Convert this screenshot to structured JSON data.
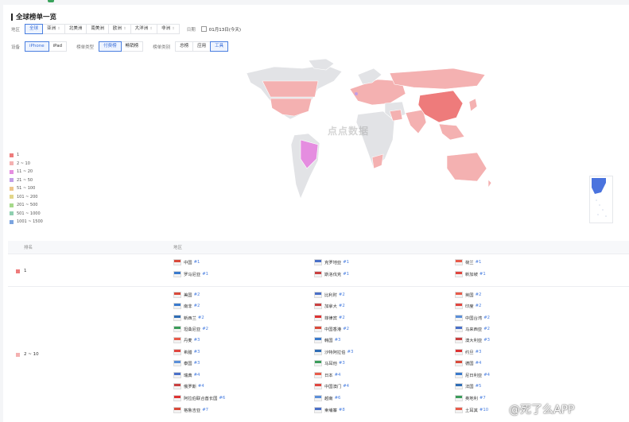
{
  "page_title": "全球榜单一览",
  "filters": {
    "region_label": "地区",
    "regions": [
      "全球",
      "亚洲",
      "北美洲",
      "南美洲",
      "欧洲",
      "大洋洲",
      "非洲"
    ],
    "regions_with_caret": [
      false,
      true,
      false,
      false,
      true,
      true,
      true
    ],
    "date_label": "日期",
    "date_value": "01月13日(今天)",
    "device_label": "设备",
    "devices": [
      "iPhone",
      "iPad"
    ],
    "list_type_label": "榜单类型",
    "list_types": [
      "付费榜",
      "畅销榜"
    ],
    "category_label": "榜单类别",
    "categories": [
      "总榜",
      "应用",
      "工具"
    ]
  },
  "map": {
    "watermark": "点点数据"
  },
  "legend": [
    {
      "label": "1",
      "color": "#ee7b7b"
    },
    {
      "label": "2 ~ 10",
      "color": "#f4b1b1"
    },
    {
      "label": "11 ~ 20",
      "color": "#e58de0"
    },
    {
      "label": "21 ~ 50",
      "color": "#c29ee6"
    },
    {
      "label": "51 ~ 100",
      "color": "#eec58c"
    },
    {
      "label": "101 ~ 200",
      "color": "#e2d68a"
    },
    {
      "label": "201 ~ 500",
      "color": "#a6d98b"
    },
    {
      "label": "501 ~ 1000",
      "color": "#8fcfb0"
    },
    {
      "label": "1001 ~ 1500",
      "color": "#7ba4e0"
    }
  ],
  "table": {
    "col_rank": "排名",
    "col_region": "地区",
    "groups": [
      {
        "rank": "1",
        "color": "#ee7b7b",
        "countries": [
          [
            "中国",
            "#1"
          ],
          [
            "克罗地亚",
            "#1"
          ],
          [
            "荷兰",
            "#1"
          ],
          [
            "罗马尼亚",
            "#1"
          ],
          [
            "斯洛伐克",
            "#1"
          ],
          [
            "新加坡",
            "#1"
          ]
        ]
      },
      {
        "rank": "2 ~ 10",
        "color": "#f4b1b1",
        "countries": [
          [
            "美国",
            "#2"
          ],
          [
            "比利时",
            "#2"
          ],
          [
            "英国",
            "#2"
          ],
          [
            "南非",
            "#2"
          ],
          [
            "加拿大",
            "#2"
          ],
          [
            "印度",
            "#2"
          ],
          [
            "新西兰",
            "#2"
          ],
          [
            "菲律宾",
            "#2"
          ],
          [
            "中国台湾",
            "#2"
          ],
          [
            "坦桑尼亚",
            "#2"
          ],
          [
            "中国香港",
            "#2"
          ],
          [
            "马来西亚",
            "#2"
          ],
          [
            "丹麦",
            "#3"
          ],
          [
            "韩国",
            "#3"
          ],
          [
            "澳大利亚",
            "#3"
          ],
          [
            "希腊",
            "#3"
          ],
          [
            "沙特阿拉伯",
            "#3"
          ],
          [
            "约旦",
            "#3"
          ],
          [
            "泰国",
            "#3"
          ],
          [
            "马耳他",
            "#3"
          ],
          [
            "德国",
            "#4"
          ],
          [
            "瑞典",
            "#4"
          ],
          [
            "日本",
            "#4"
          ],
          [
            "尼日利亚",
            "#4"
          ],
          [
            "俄罗斯",
            "#4"
          ],
          [
            "中国澳门",
            "#4"
          ],
          [
            "法国",
            "#5"
          ],
          [
            "阿拉伯联合酋长国",
            "#6"
          ],
          [
            "越南",
            "#6"
          ],
          [
            "奥地利",
            "#7"
          ],
          [
            "格鲁吉亚",
            "#7"
          ],
          [
            "柬埔寨",
            "#8"
          ],
          [
            "土耳其",
            "#10"
          ]
        ]
      }
    ]
  },
  "corner_watermark": "@死了么APP"
}
